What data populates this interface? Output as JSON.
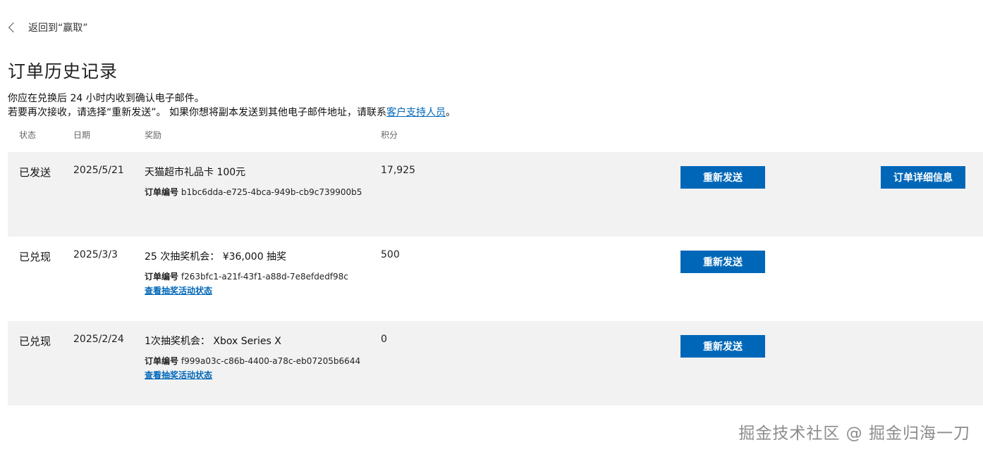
{
  "back_link": {
    "label": "返回到“赢取”"
  },
  "page_title": "订单历史记录",
  "info": {
    "line1": "你应在兑换后 24 小时内收到确认电子邮件。",
    "line2_prefix": "若要再次接收，请选择“重新发送”。 如果你想将副本发送到其他电子邮件地址，请联系",
    "support_link": "客户支持人员",
    "line2_suffix": "。"
  },
  "columns": {
    "status": "状态",
    "date": "日期",
    "reward": "奖励",
    "points": "积分"
  },
  "order_label": "订单编号",
  "orders": [
    {
      "status": "已发送",
      "date": "2025/5/21",
      "reward": "天猫超市礼品卡 100元",
      "order_id": "b1bc6dda-e725-4bca-949b-cb9c739900b5",
      "points": "17,925",
      "resend_label": "重新发送",
      "details_label": "订单详细信息"
    },
    {
      "status": "已兑现",
      "date": "2025/3/3",
      "reward": "25 次抽奖机会： ¥36,000 抽奖",
      "order_id": "f263bfc1-a21f-43f1-a88d-7e8efdedf98c",
      "link": "查看抽奖活动状态",
      "points": "500",
      "resend_label": "重新发送"
    },
    {
      "status": "已兑现",
      "date": "2025/2/24",
      "reward": "1次抽奖机会： Xbox Series X",
      "order_id": "f999a03c-c86b-4400-a78c-eb07205b6644",
      "link": "查看抽奖活动状态",
      "points": "0",
      "resend_label": "重新发送"
    }
  ],
  "watermark": "掘金技术社区 @ 掘金归海一刀",
  "colors": {
    "accent": "#0067b8",
    "row_shade": "#f2f2f2"
  }
}
